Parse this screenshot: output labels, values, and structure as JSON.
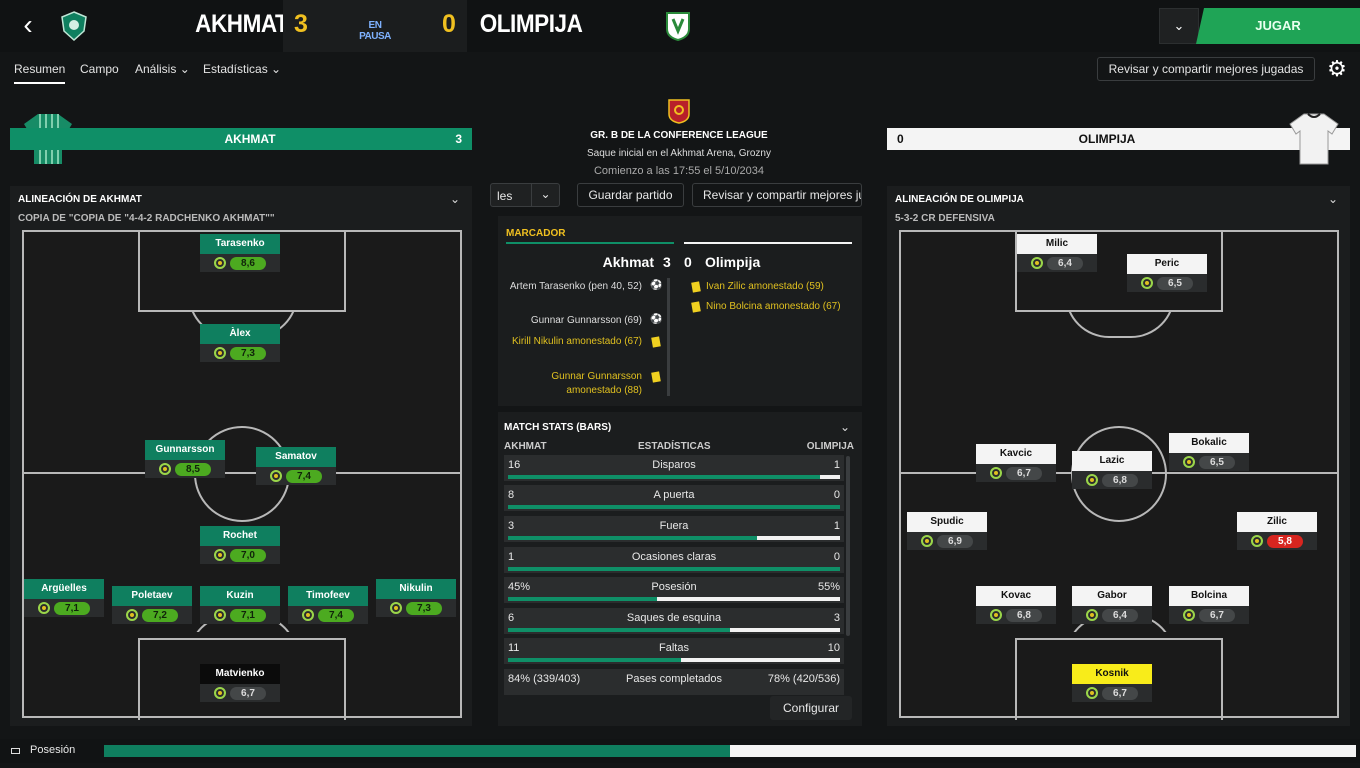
{
  "header": {
    "home_team": "AKHMAT",
    "away_team": "OLIMPIJA",
    "home_score": "3",
    "away_score": "0",
    "status": "EN PAUSA",
    "play_label": "JUGAR",
    "dropdown_icon": "chevron-down-icon"
  },
  "tabs": [
    "Resumen",
    "Campo",
    "Análisis",
    "Estadísticas"
  ],
  "review_label": "Revisar y compartir mejores jugadas",
  "home_banner": {
    "name": "AKHMAT",
    "score": "3"
  },
  "away_banner": {
    "name": "OLIMPIJA",
    "score": "0"
  },
  "match_info": {
    "competition": "GR. B DE LA CONFERENCE LEAGUE",
    "kickoff": "Saque inicial en el Akhmat Arena, Grozny",
    "start": "Comienzo a las 17:55 el 5/10/2034"
  },
  "mid_toolbar": {
    "cut_label": "les",
    "save": "Guardar partido",
    "review": "Revisar y compartir mejores ju"
  },
  "scoreboard": {
    "title": "MARCADOR",
    "home": "Akhmat",
    "home_score": "3",
    "away_score": "0",
    "away": "Olimpija",
    "home_events": [
      "Artem Tarasenko (pen 40, 52)",
      "Gunnar Gunnarsson (69)",
      "Kirill Nikulin amonestado (67)",
      "Gunnar Gunnarsson amonestado (88)"
    ],
    "away_events": [
      "Ivan Zilic amonestado (59)",
      "Nino Bolcina amonestado (67)"
    ]
  },
  "stats": {
    "title": "MATCH STATS (BARS)",
    "home": "AKHMAT",
    "center": "ESTADÍSTICAS",
    "away": "OLIMPIJA",
    "configure": "Configurar",
    "rows": [
      {
        "l": "16",
        "label": "Disparos",
        "r": "1",
        "hp": 0.94
      },
      {
        "l": "8",
        "label": "A puerta",
        "r": "0",
        "hp": 1.0
      },
      {
        "l": "3",
        "label": "Fuera",
        "r": "1",
        "hp": 0.75
      },
      {
        "l": "1",
        "label": "Ocasiones claras",
        "r": "0",
        "hp": 1.0
      },
      {
        "l": "45%",
        "label": "Posesión",
        "r": "55%",
        "hp": 0.45
      },
      {
        "l": "6",
        "label": "Saques de esquina",
        "r": "3",
        "hp": 0.67
      },
      {
        "l": "11",
        "label": "Faltas",
        "r": "10",
        "hp": 0.52
      },
      {
        "l": "84% (339/403)",
        "label": "Pases completados",
        "r": "78% (420/536)",
        "hp": null
      }
    ]
  },
  "home_lineup": {
    "title": "ALINEACIÓN DE AKHMAT",
    "formation": "COPIA DE \"COPIA DE \"4-4-2 RADCHENKO AKHMAT\"\"",
    "players": [
      {
        "name": "Tarasenko",
        "rating": "8,6",
        "cls": "g"
      },
      {
        "name": "Àlex",
        "rating": "7,3",
        "cls": "g"
      },
      {
        "name": "Gunnarsson",
        "rating": "8,5",
        "cls": "g"
      },
      {
        "name": "Samatov",
        "rating": "7,4",
        "cls": "g"
      },
      {
        "name": "Rochet",
        "rating": "7,0",
        "cls": "g"
      },
      {
        "name": "Argüelles",
        "rating": "7,1",
        "cls": "g"
      },
      {
        "name": "Poletaev",
        "rating": "7,2",
        "cls": "g"
      },
      {
        "name": "Kuzin",
        "rating": "7,1",
        "cls": "g"
      },
      {
        "name": "Timofeev",
        "rating": "7,4",
        "cls": "g"
      },
      {
        "name": "Nikulin",
        "rating": "7,3",
        "cls": "g"
      },
      {
        "name": "Matvienko",
        "rating": "6,7",
        "cls": "d"
      }
    ]
  },
  "away_lineup": {
    "title": "ALINEACIÓN DE OLIMPIJA",
    "formation": "5-3-2 CR DEFENSIVA",
    "players": [
      {
        "name": "Milic",
        "rating": "6,4",
        "cls": "d"
      },
      {
        "name": "Peric",
        "rating": "6,5",
        "cls": "d"
      },
      {
        "name": "Kavcic",
        "rating": "6,7",
        "cls": "d"
      },
      {
        "name": "Lazic",
        "rating": "6,8",
        "cls": "d"
      },
      {
        "name": "Bokalic",
        "rating": "6,5",
        "cls": "d"
      },
      {
        "name": "Spudic",
        "rating": "6,9",
        "cls": "d"
      },
      {
        "name": "Zilic",
        "rating": "5,8",
        "cls": "r"
      },
      {
        "name": "Kovac",
        "rating": "6,8",
        "cls": "d"
      },
      {
        "name": "Gabor",
        "rating": "6,4",
        "cls": "d"
      },
      {
        "name": "Bolcina",
        "rating": "6,7",
        "cls": "d"
      },
      {
        "name": "Kosnik",
        "rating": "6,7",
        "cls": "d"
      }
    ]
  },
  "possession": {
    "label": "Posesión",
    "home": 0.5
  },
  "colors": {
    "home": "#0f7f5f",
    "away": "#f4f4f4",
    "accent": "#1fa456",
    "score": "#f0c020"
  }
}
